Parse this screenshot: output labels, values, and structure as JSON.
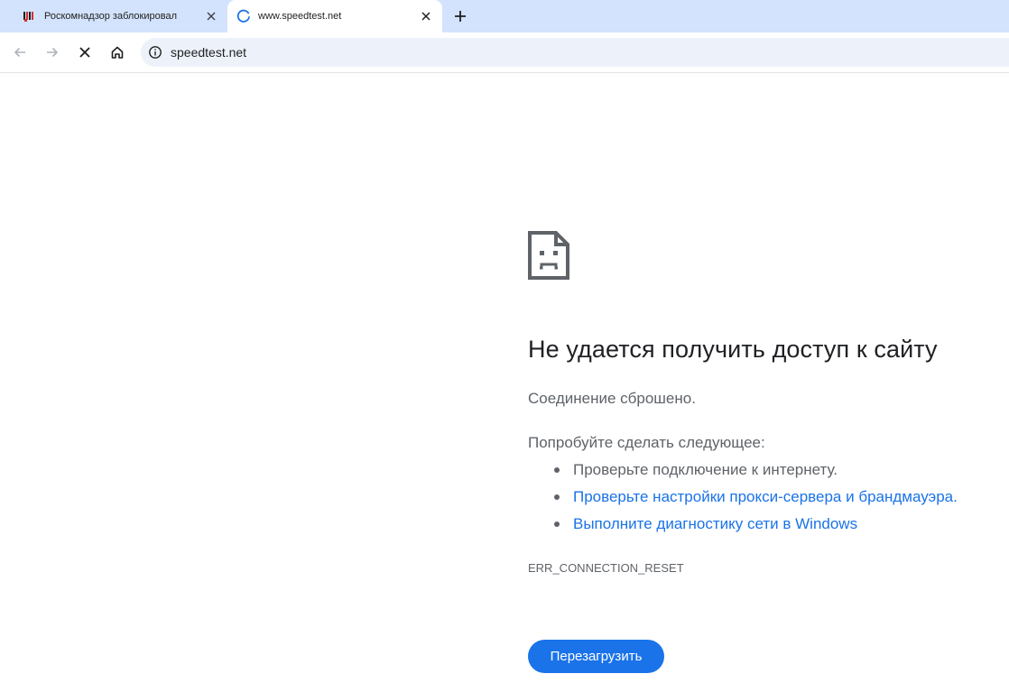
{
  "tabs": [
    {
      "title": "Роскомнадзор заблокировал в РФ",
      "active": false
    },
    {
      "title": "www.speedtest.net",
      "active": true
    }
  ],
  "toolbar": {
    "url": "speedtest.net"
  },
  "error": {
    "title": "Не удается получить доступ к сайту",
    "subtitle": "Соединение сброшено.",
    "try_heading": "Попробуйте сделать следующее:",
    "suggestions": [
      {
        "text": "Проверьте подключение к интернету.",
        "link": false
      },
      {
        "text": "Проверьте настройки прокси-сервера и брандмауэра.",
        "link": true
      },
      {
        "text": "Выполните диагностику сети в Windows",
        "link": true
      }
    ],
    "code": "ERR_CONNECTION_RESET",
    "reload_label": "Перезагрузить"
  },
  "icons": {
    "tab1_favicon": "news-favicon-icon",
    "tab2_favicon": "loading-spinner-icon",
    "back": "arrow-left-icon",
    "forward": "arrow-right-icon",
    "stop": "stop-x-icon",
    "home": "home-icon",
    "site_info": "info-icon",
    "error": "sad-page-icon"
  },
  "colors": {
    "tabstrip": "#d3e3fd",
    "omnibox": "#edf2fa",
    "link": "#1a73e8",
    "button": "#1a73e8",
    "title": "#202124",
    "text": "#5f6368"
  }
}
